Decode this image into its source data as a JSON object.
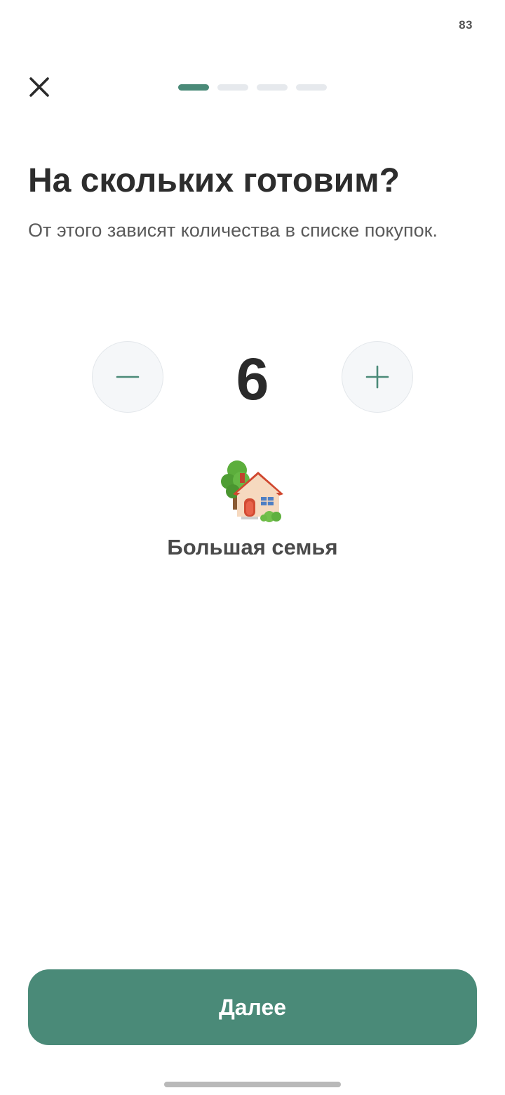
{
  "status_bar": {
    "value": "83"
  },
  "header": {
    "close_icon": "close-icon",
    "progress": {
      "total_steps": 4,
      "current_step": 1
    }
  },
  "main": {
    "title": "На скольких готовим?",
    "subtitle": "От этого зависят количества в списке покупок.",
    "stepper": {
      "value": "6",
      "minus_icon": "minus-icon",
      "plus_icon": "plus-icon"
    },
    "family": {
      "icon": "house-with-garden-icon",
      "label": "Большая семья"
    }
  },
  "footer": {
    "next_label": "Далее"
  },
  "colors": {
    "accent": "#4a8a78",
    "inactive_progress": "#e6e9ed",
    "stepper_bg": "#f5f7f9"
  }
}
